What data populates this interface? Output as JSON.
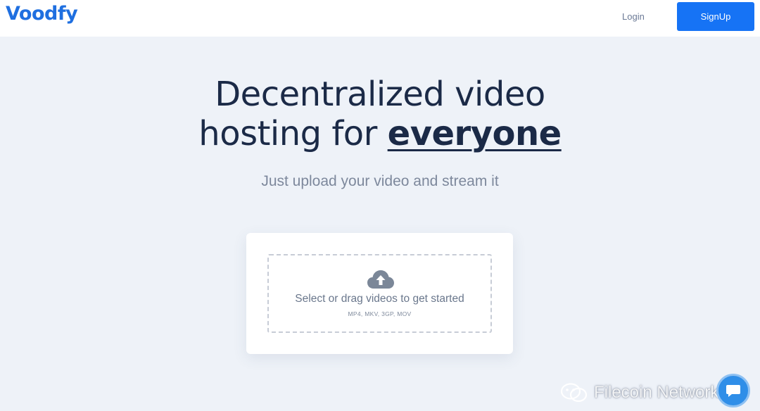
{
  "header": {
    "logo": "Voodfy",
    "login_label": "Login",
    "signup_label": "SignUp"
  },
  "hero": {
    "title_line1": "Decentralized video",
    "title_line2_prefix": "hosting for ",
    "title_line2_emphasis": "everyone",
    "subtitle": "Just upload your video and stream it"
  },
  "upload": {
    "icon": "cloud-upload-icon",
    "prompt": "Select or drag videos to get started",
    "formats": "MP4, MKV, 3GP, MOV"
  },
  "watermark": {
    "icon": "wechat-icon",
    "text": "Filecoin Network"
  },
  "chat": {
    "icon": "chat-bubble-icon"
  },
  "colors": {
    "brand": "#1f6fe0",
    "signup_bg": "#1673f5",
    "background": "#eef2f8",
    "heading": "#1b2a47",
    "muted": "#7d889c"
  }
}
